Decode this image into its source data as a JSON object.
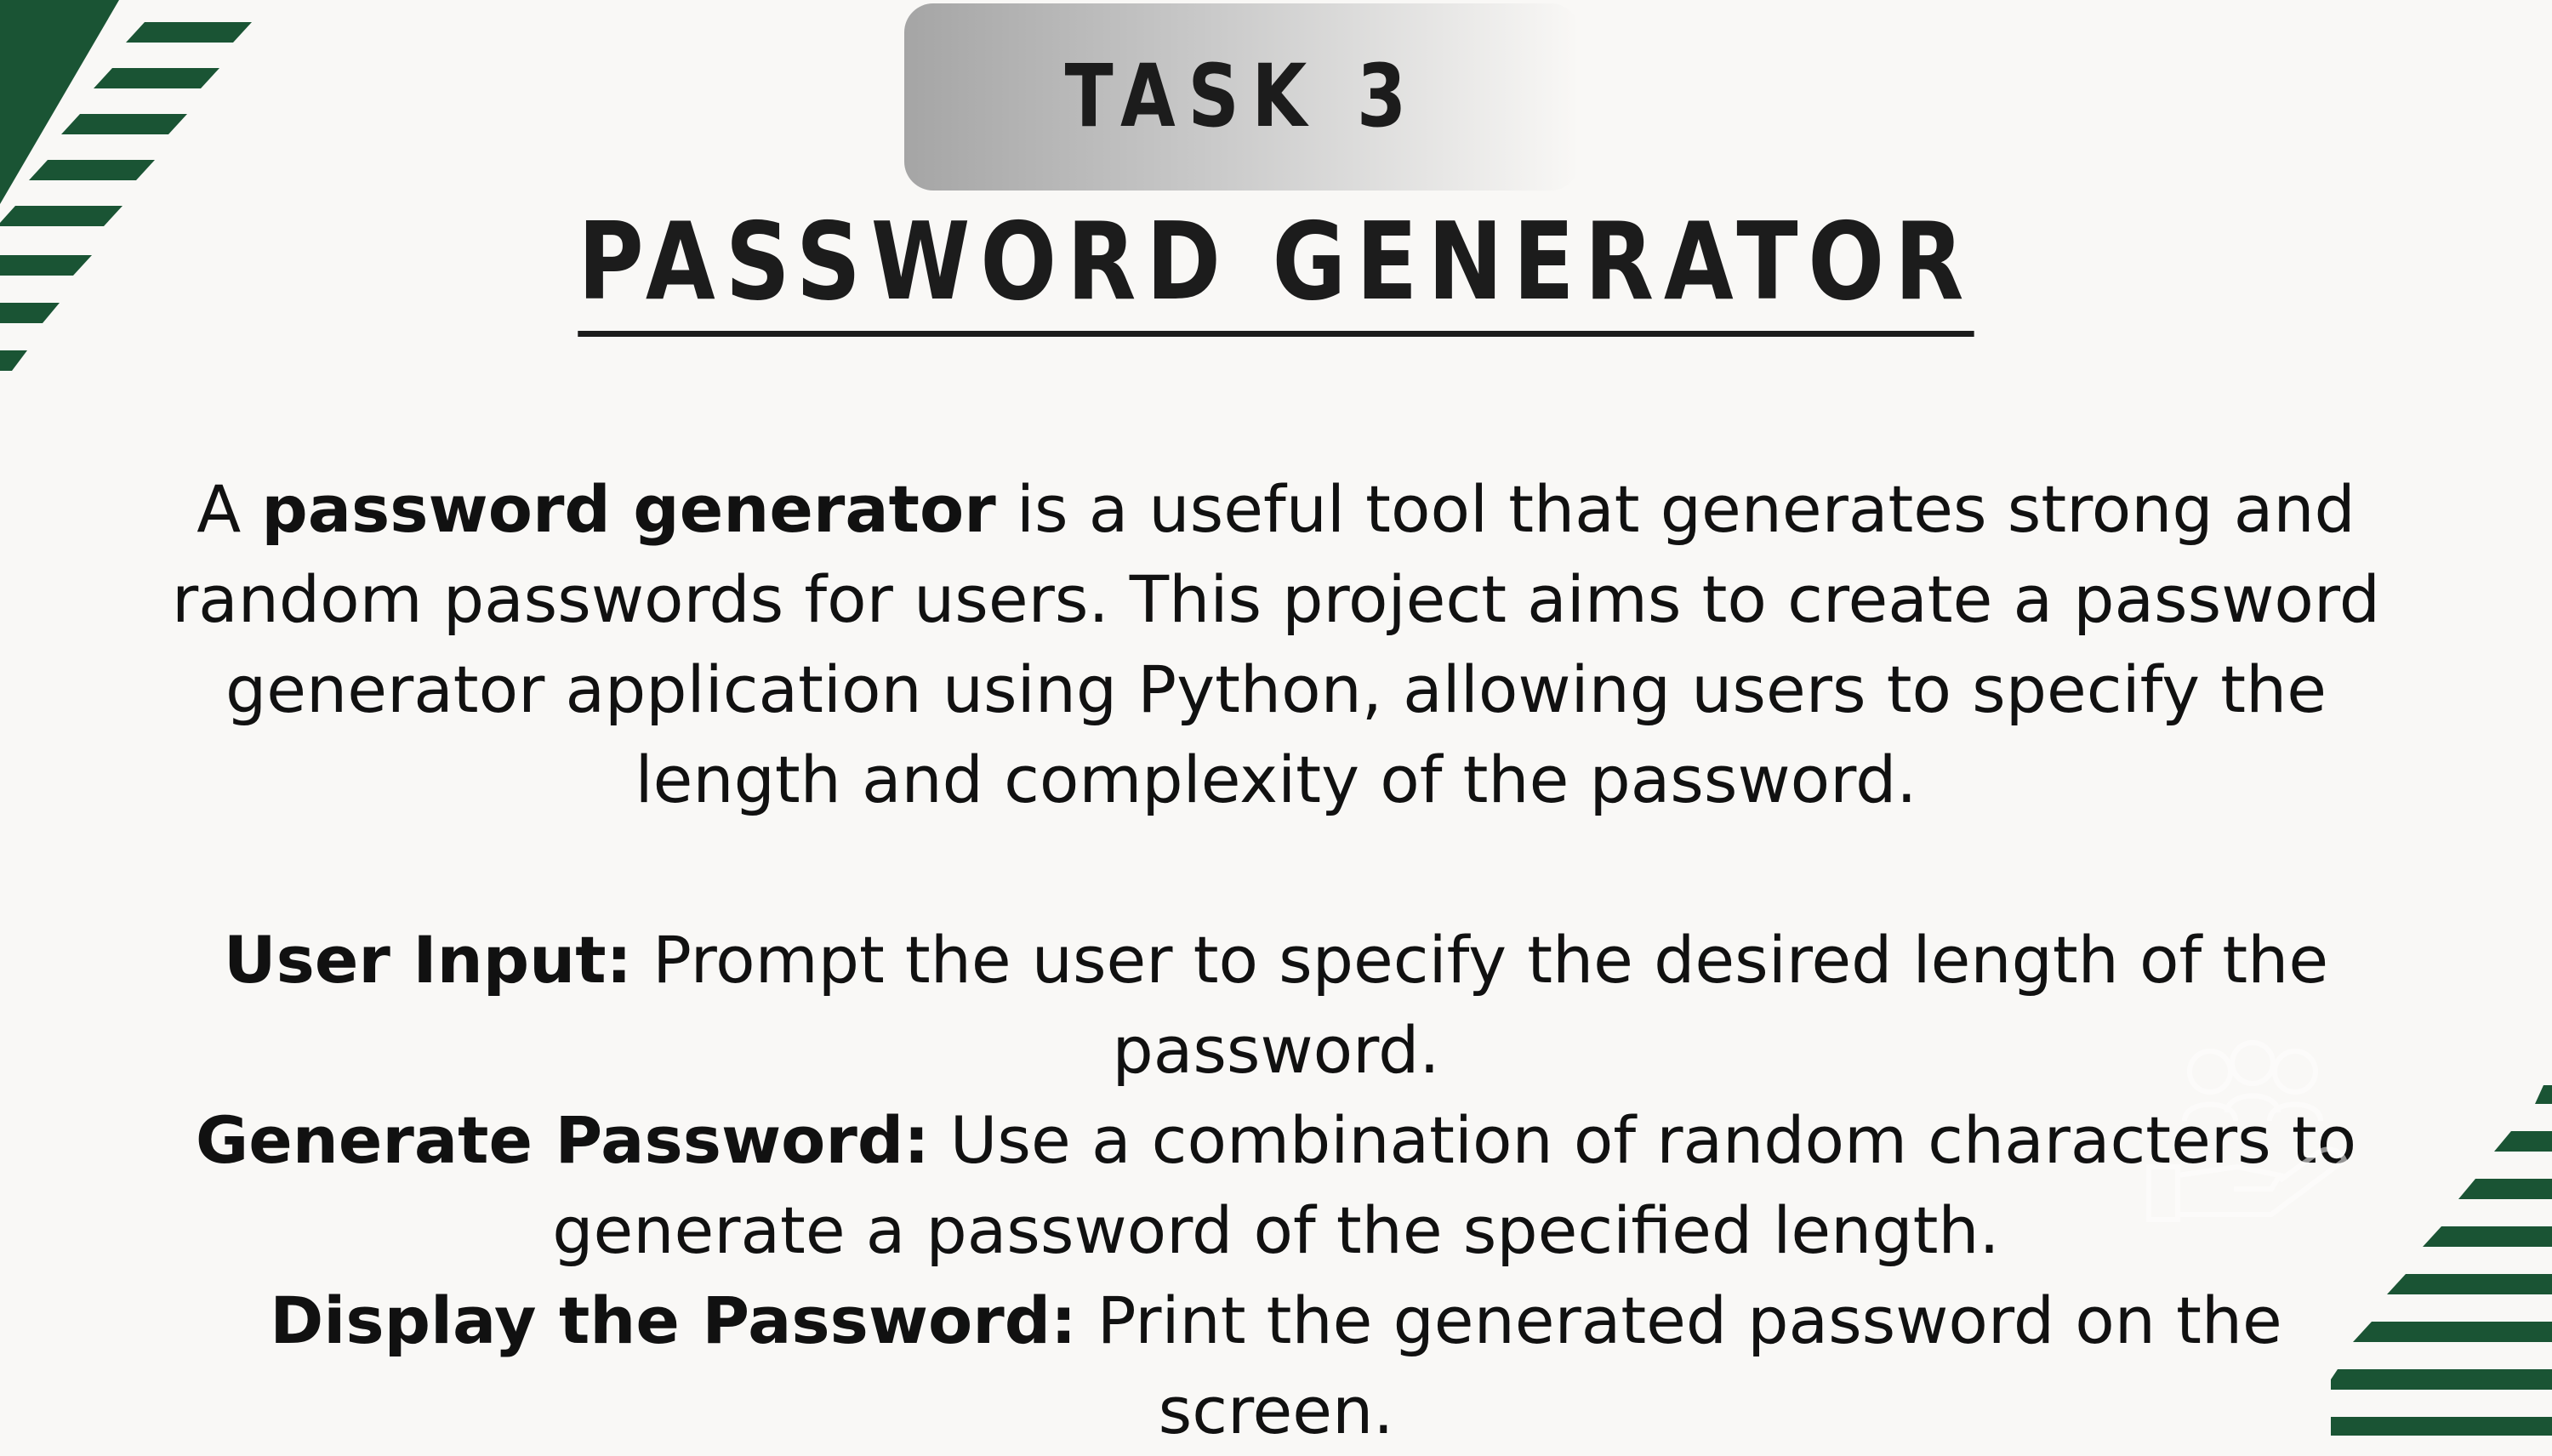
{
  "slide": {
    "badge_label": "TASK 3",
    "title": "PASSWORD GENERATOR",
    "intro": {
      "lead": "A ",
      "bold": "password generator",
      "rest": " is a useful tool that generates strong and random passwords for users. This project aims to create a password generator application using Python, allowing users to specify the length and complexity of the password."
    },
    "steps": [
      {
        "label": "User Input:",
        "text": " Prompt the user to specify the desired length of the password."
      },
      {
        "label": "Generate Password:",
        "text": " Use a combination of random characters to generate a password of the specified length."
      },
      {
        "label": "Display the Password:",
        "text": " Print the generated password on the screen."
      }
    ]
  },
  "colors": {
    "accent_green": "#1a5434",
    "background": "#f9f8f6",
    "text": "#111111",
    "badge_gray": "#a5a5a5"
  },
  "icons": {
    "watermark": "team-hand-icon"
  }
}
